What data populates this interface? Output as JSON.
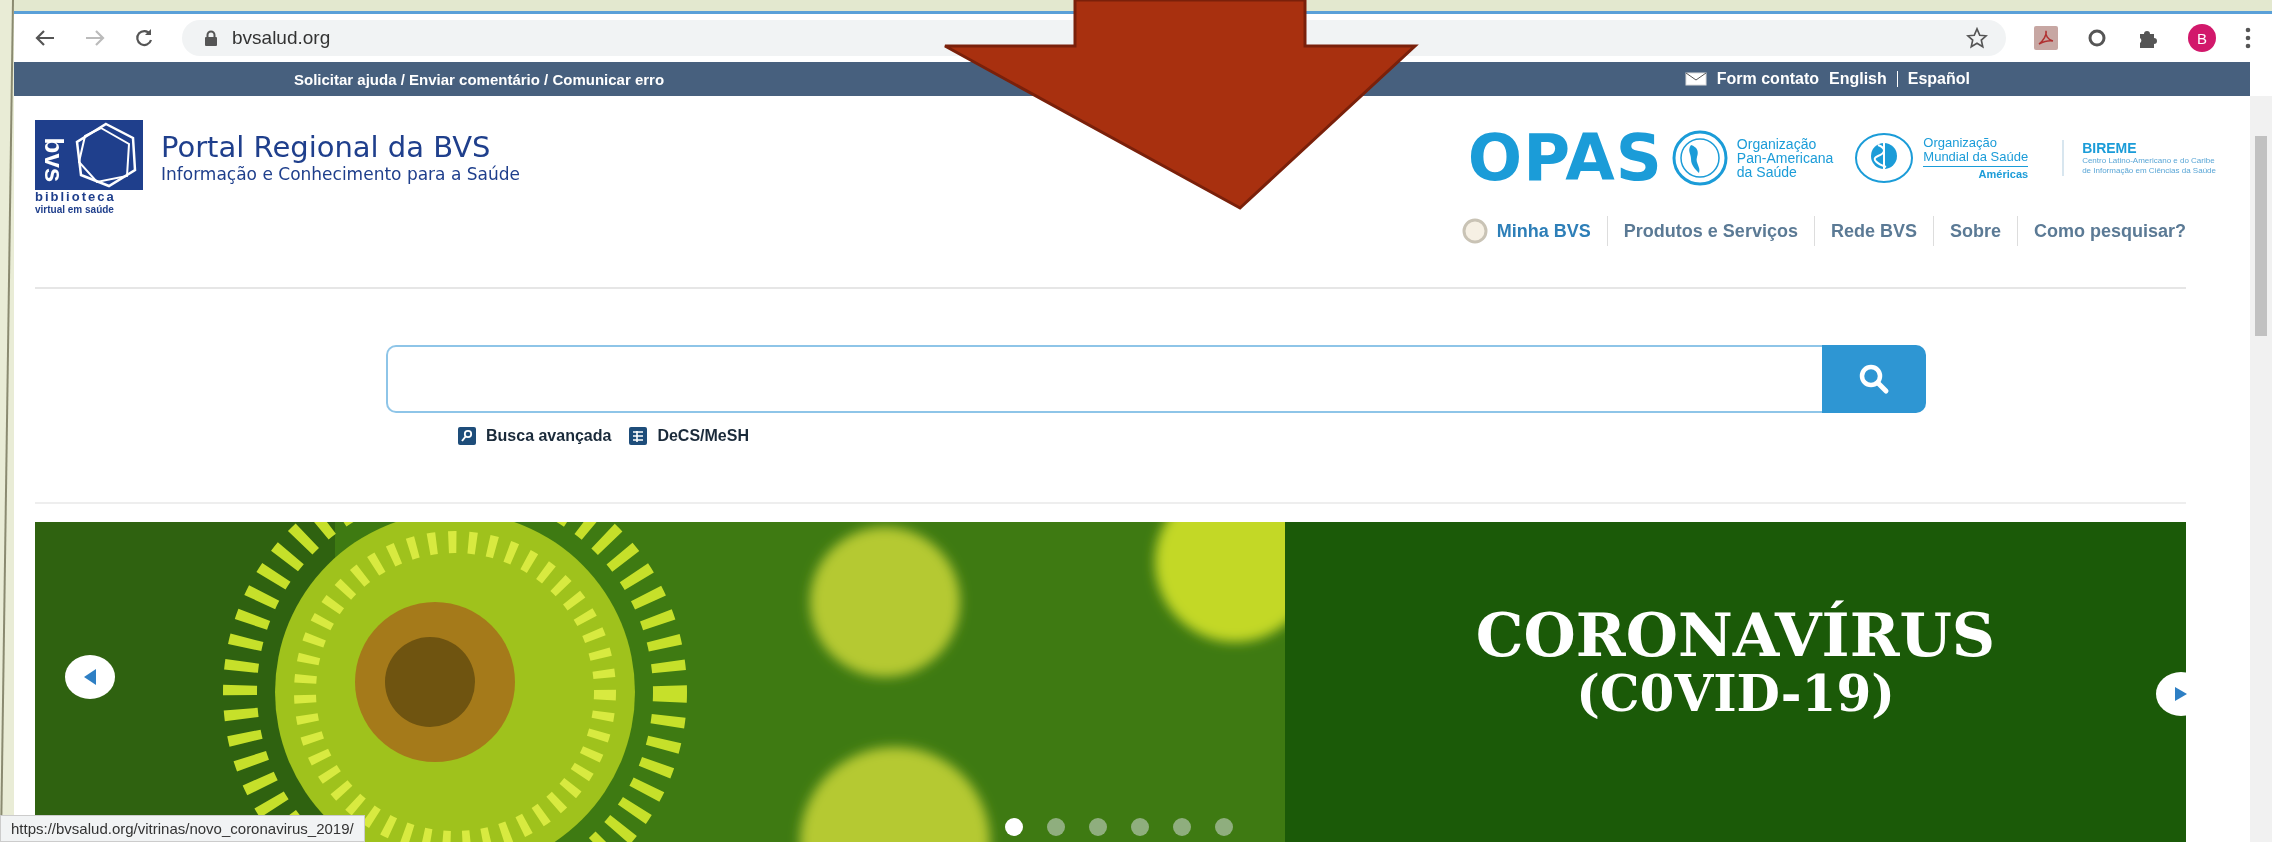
{
  "browser": {
    "url": "bvsalud.org",
    "avatar": "B"
  },
  "top_bar": {
    "help_links": "Solicitar ajuda / Enviar comentário / Comunicar erro",
    "contact": "Form contato",
    "languages": [
      "English",
      "Español"
    ]
  },
  "header": {
    "logo_mark": "bvs",
    "logo_lines": [
      "biblioteca",
      "virtual em saúde"
    ],
    "title": "Portal Regional da BVS",
    "subtitle": "Informação e Conhecimento para a Saúde"
  },
  "partners": {
    "opas": "OPAS",
    "paho_lines": [
      "Organização",
      "Pan-Americana",
      "da Saúde"
    ],
    "who_lines": [
      "Organização",
      "Mundial da Saúde"
    ],
    "who_region": "Américas",
    "bireme": "BIREME",
    "bireme_lines": [
      "Centro Latino-Americano e do Caribe",
      "de Informação em Ciências da Saúde"
    ]
  },
  "nav": [
    {
      "label": "Minha BVS",
      "kind": "account"
    },
    {
      "label": "Produtos e Serviços",
      "kind": "link"
    },
    {
      "label": "Rede BVS",
      "kind": "link"
    },
    {
      "label": "Sobre",
      "kind": "link"
    },
    {
      "label": "Como pesquisar?",
      "kind": "link"
    }
  ],
  "search": {
    "tools": [
      {
        "label": "Busca avançada",
        "kind": "advanced"
      },
      {
        "label": "DeCS/MeSH",
        "kind": "thesaurus"
      }
    ]
  },
  "carousel": {
    "title": "CORONAVÍRUS",
    "subtitle": "(C0VID-19)",
    "slides": [
      {
        "selected": true
      },
      {
        "selected": false
      },
      {
        "selected": false
      },
      {
        "selected": false
      },
      {
        "selected": false
      },
      {
        "selected": false
      }
    ]
  },
  "status_url": "https://bvsalud.org/vitrinas/novo_coronavirus_2019/"
}
